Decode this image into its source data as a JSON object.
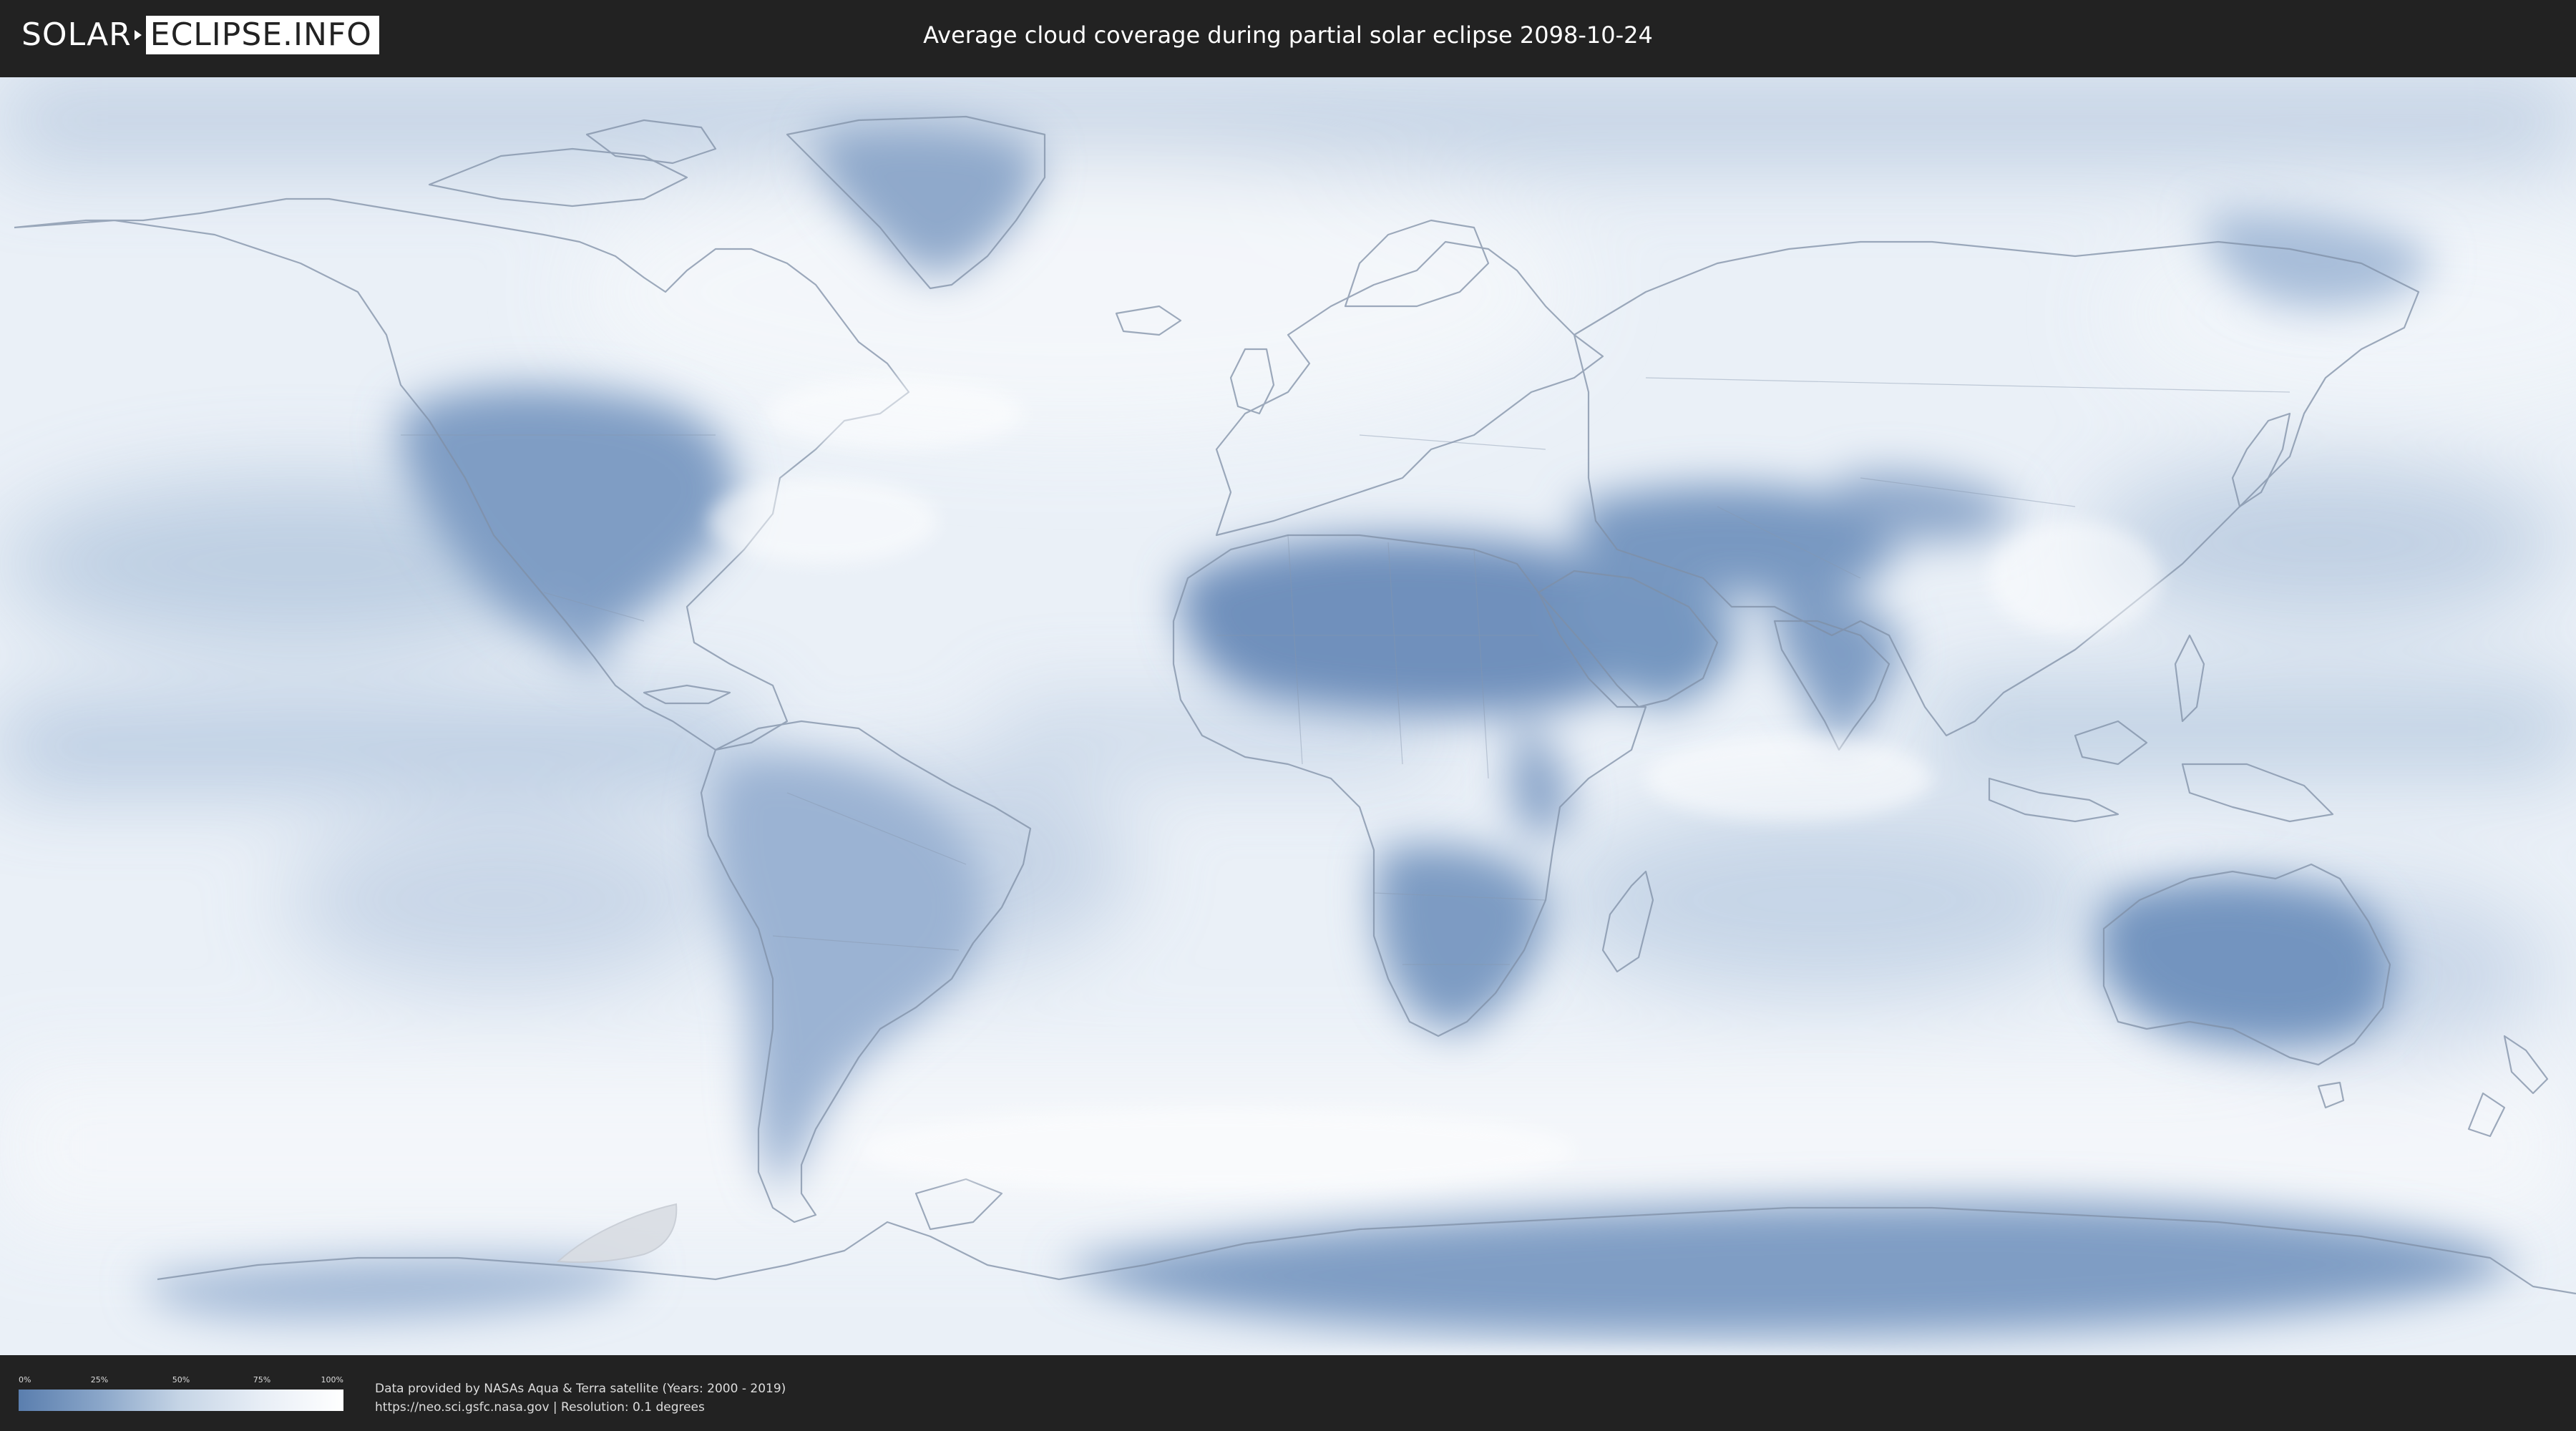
{
  "header": {
    "logo_left": "SOLAR",
    "logo_right": "ECLIPSE.INFO",
    "title": "Average cloud coverage during partial solar eclipse 2098-10-24"
  },
  "map": {
    "description_icon": "world-map",
    "colors": {
      "clear_sky": "#5a7eae",
      "medium": "#a9bfda",
      "full_cloud": "#ffffff",
      "border_lines": "#7f8fa6",
      "eclipse_shadow": "#d9dde3"
    }
  },
  "legend": {
    "ticks": [
      "0%",
      "25%",
      "50%",
      "75%",
      "100%"
    ]
  },
  "credits": {
    "line1": "Data provided by NASAs Aqua & Terra satellite (Years: 2000 - 2019)",
    "line2": "https://neo.sci.gsfc.nasa.gov | Resolution: 0.1 degrees"
  }
}
